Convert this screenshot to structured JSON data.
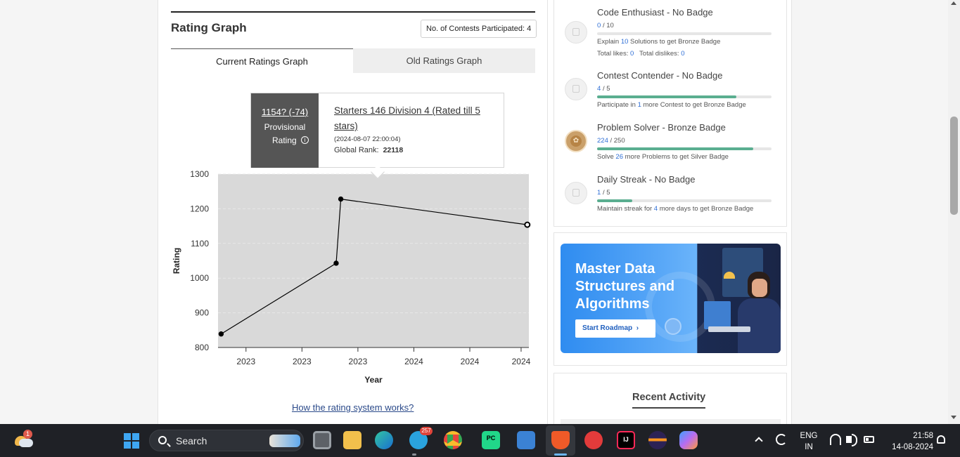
{
  "rating_section": {
    "title": "Rating Graph",
    "contest_count": "No. of Contests Participated: 4",
    "tabs": [
      {
        "label": "Current Ratings Graph",
        "active": true
      },
      {
        "label": "Old Ratings Graph",
        "active": false
      }
    ],
    "tooltip": {
      "rating": "1154? (-74)",
      "provisional": "Provisional",
      "rating_label": "Rating",
      "contest": "Starters 146 Division 4 (Rated till 5 stars)",
      "date": "(2024-08-07 22:00:04)",
      "rank_label": "Global Rank:",
      "rank_value": "22118"
    },
    "link": "How the rating system works?"
  },
  "chart_data": {
    "type": "line",
    "xlabel": "Year",
    "ylabel": "Rating",
    "ylim": [
      800,
      1300
    ],
    "yticks": [
      800,
      900,
      1000,
      1100,
      1200,
      1300
    ],
    "xtick_labels": [
      "2023",
      "2023",
      "2023",
      "2024",
      "2024",
      "2024"
    ],
    "xtick_positions": [
      0.09,
      0.27,
      0.45,
      0.63,
      0.81,
      0.975
    ],
    "x": [
      0.01,
      0.38,
      0.395,
      0.995
    ],
    "values": [
      839,
      1043,
      1228,
      1154
    ],
    "last_point_open": true,
    "grid": true,
    "background": "#d9d9d9",
    "line_color": "#000000"
  },
  "badges": [
    {
      "title": "Code Enthusiast - No Badge",
      "current": "0",
      "target": "/ 10",
      "fraction": 0.0,
      "desc_parts": [
        "Explain ",
        "10",
        " Solutions to get Bronze Badge"
      ],
      "extra": {
        "likes_label": "Total likes:",
        "likes": "0",
        "dislikes_label": "Total dislikes:",
        "dislikes": "0"
      },
      "earned": false
    },
    {
      "title": "Contest Contender - No Badge",
      "current": "4",
      "target": "/ 5",
      "fraction": 0.8,
      "desc_parts": [
        "Participate in ",
        "1",
        " more Contest to get Bronze Badge"
      ],
      "earned": false
    },
    {
      "title": "Problem Solver - Bronze Badge",
      "current": "224",
      "target": "/ 250",
      "fraction": 0.896,
      "desc_parts": [
        "Solve ",
        "26",
        " more Problems to get Silver Badge"
      ],
      "earned": true
    },
    {
      "title": "Daily Streak - No Badge",
      "current": "1",
      "target": "/ 5",
      "fraction": 0.2,
      "desc_parts": [
        "Maintain streak for ",
        "4",
        " more days to get Bronze Badge"
      ],
      "earned": false
    }
  ],
  "promo": {
    "title": "Master Data Structures and Algorithms",
    "button": "Start Roadmap",
    "button_icon": "chevron-right-icon"
  },
  "activity": {
    "title": "Recent Activity"
  },
  "taskbar": {
    "weather_badge": "1",
    "search_label": "Search",
    "telegram_count": "257",
    "pycharm_label": "PC",
    "intellij_label": "IJ",
    "lang_line1": "ENG",
    "lang_line2": "IN",
    "time": "21:58",
    "date": "14-08-2024"
  },
  "colors": {
    "progress_fill": "#5aae90",
    "link_blue": "#2f6fd6",
    "taskbar_bg": "#1f2126"
  }
}
